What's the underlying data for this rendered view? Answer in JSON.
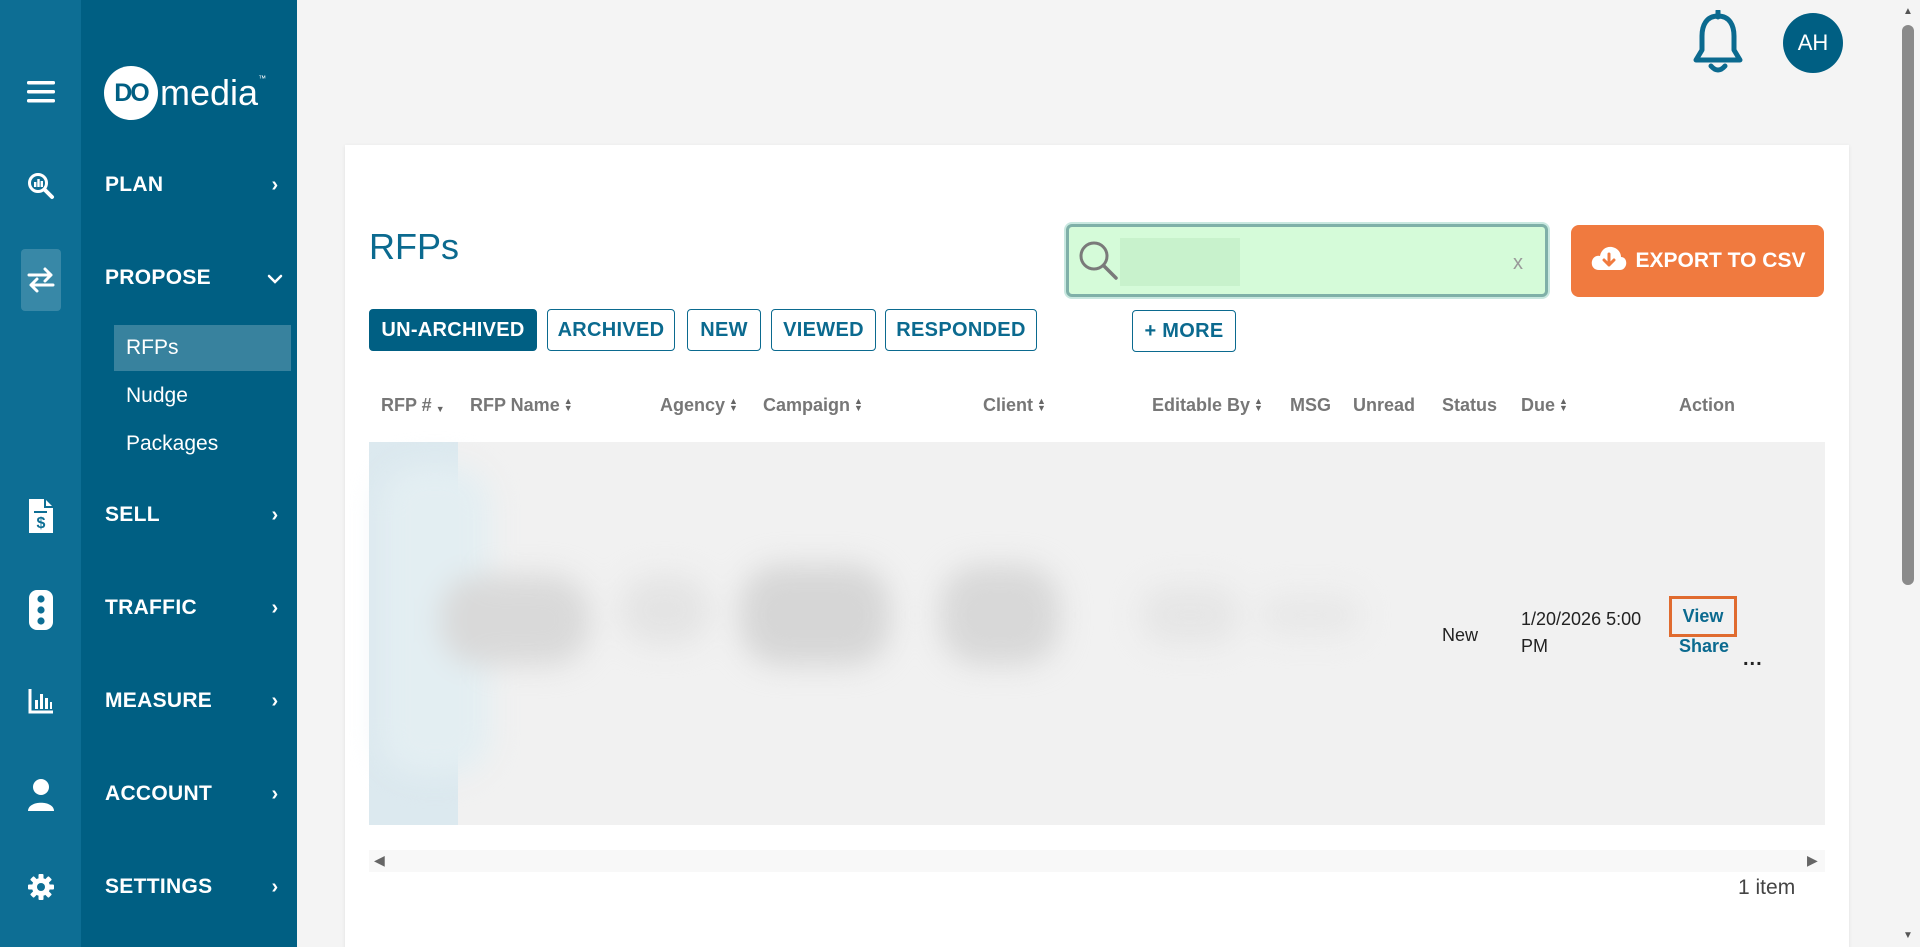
{
  "brand": {
    "logo_mark": "DO",
    "logo_word": "media",
    "logo_tm": "™"
  },
  "nav": {
    "items": [
      {
        "label": "PLAN",
        "icon": "search-chart-icon",
        "chevron": "›"
      },
      {
        "label": "PROPOSE",
        "icon": "swap-arrows-icon",
        "chevron": "⌄"
      },
      {
        "label": "SELL",
        "icon": "invoice-dollar-icon",
        "chevron": "›"
      },
      {
        "label": "TRAFFIC",
        "icon": "traffic-light-icon",
        "chevron": "›"
      },
      {
        "label": "MEASURE",
        "icon": "bar-chart-icon",
        "chevron": "›"
      },
      {
        "label": "ACCOUNT",
        "icon": "user-icon",
        "chevron": "›"
      },
      {
        "label": "SETTINGS",
        "icon": "gear-icon",
        "chevron": "›"
      }
    ],
    "propose_sub": [
      {
        "label": "RFPs"
      },
      {
        "label": "Nudge"
      },
      {
        "label": "Packages"
      }
    ]
  },
  "header": {
    "avatar_initials": "AH"
  },
  "page": {
    "title": "RFPs",
    "search": {
      "value": "",
      "placeholder": "",
      "clear": "x"
    },
    "export_label": "EXPORT TO CSV",
    "filters": [
      "UN-ARCHIVED",
      "ARCHIVED",
      "NEW",
      "VIEWED",
      "RESPONDED"
    ],
    "more_label": "+ MORE"
  },
  "table": {
    "columns": [
      "RFP #",
      "RFP Name",
      "Agency",
      "Campaign",
      "Client",
      "Editable By",
      "MSG",
      "Unread",
      "Status",
      "Due",
      "Action"
    ],
    "rows": [
      {
        "status": "New",
        "due_line1": "1/20/2026 5:00",
        "due_line2": "PM",
        "action_view": "View",
        "action_share": "Share",
        "action_more": "..."
      }
    ],
    "item_count": "1 item"
  },
  "colors": {
    "sidebar_rail": "#0d6e94",
    "sidebar_panel": "#005f83",
    "accent": "#0b6a8f",
    "export_button": "#f07a3f",
    "search_bg": "#d5fbd9",
    "highlight_border": "#e06b2f"
  }
}
